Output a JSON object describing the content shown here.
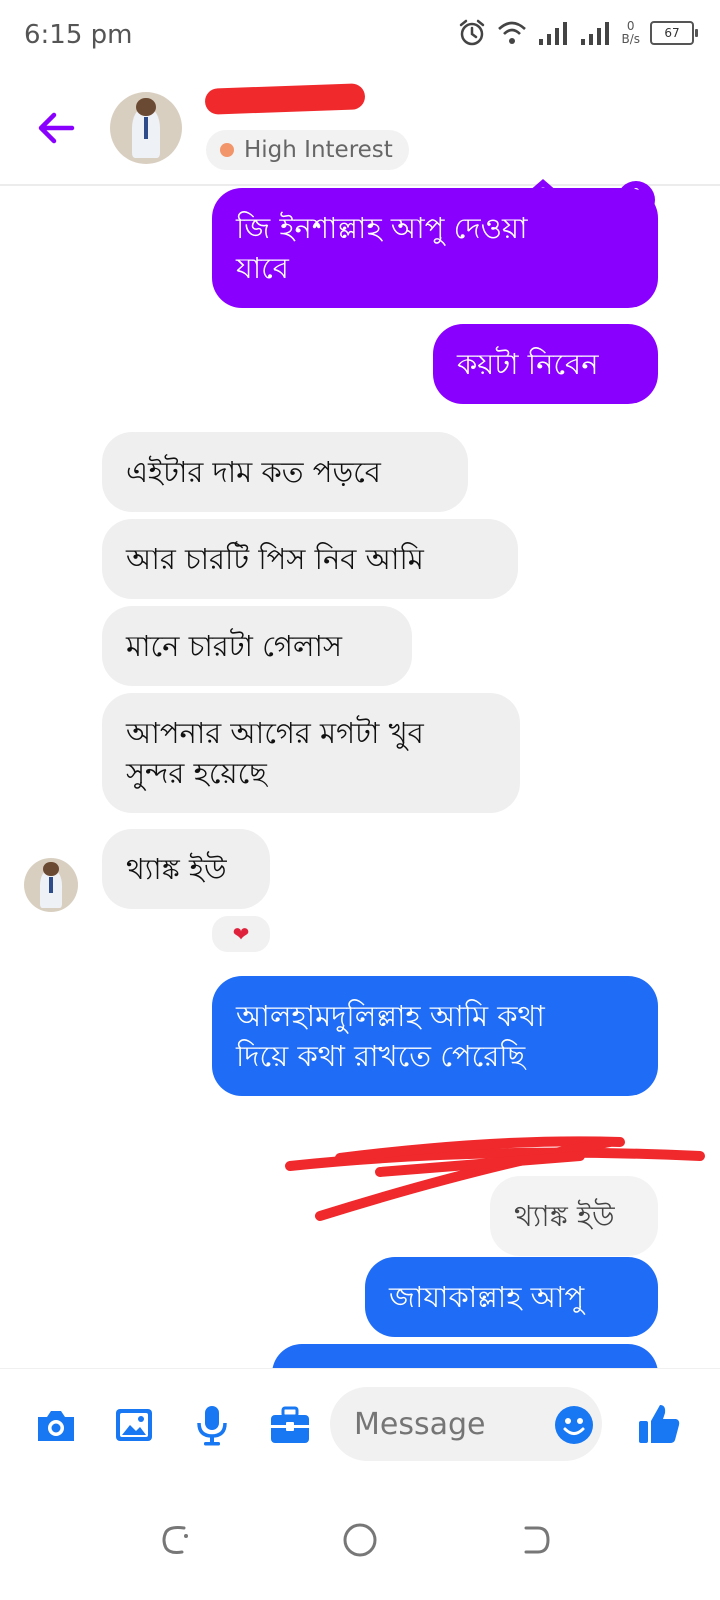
{
  "status_bar": {
    "time": "6:15 pm",
    "net_speed_value": "0",
    "net_speed_unit": "B/s",
    "battery": "67"
  },
  "header": {
    "interest_label": "High Interest",
    "interest_color": "#f2956b"
  },
  "colors": {
    "accent": "#8a00ff",
    "blue": "#1f6cf6",
    "incoming": "#efefef"
  },
  "messages": [
    {
      "dir": "out",
      "text": "জি ইনশাল্লাহ আপু দেওয়া\nযাবে"
    },
    {
      "dir": "out",
      "text": "কয়টা নিবেন"
    },
    {
      "dir": "in",
      "text": "এইটার দাম কত পড়বে"
    },
    {
      "dir": "in",
      "text": "আর চারটি পিস নিব আমি"
    },
    {
      "dir": "in",
      "text": "মানে চারটা গেলাস"
    },
    {
      "dir": "in",
      "text": "আপনার আগের মগটা খুব\nসুন্দর হয়েছে"
    },
    {
      "dir": "in",
      "text": "থ্যাঙ্ক ইউ",
      "reaction": "❤"
    },
    {
      "dir": "out",
      "text": "আলহামদুলিল্লাহ আমি কথা\nদিয়ে কথা রাখতে পেরেছি"
    },
    {
      "dir": "reply",
      "text": "থ্যাঙ্ক ইউ"
    },
    {
      "dir": "out",
      "text": "জাযাকাল্লাহ আপু"
    }
  ],
  "composer": {
    "placeholder": "Message",
    "icons": [
      "camera-icon",
      "gallery-icon",
      "microphone-icon",
      "briefcase-icon",
      "emoji-icon",
      "thumbs-up-icon"
    ]
  },
  "nav": {
    "icons": [
      "recent-apps-icon",
      "home-icon",
      "back-icon"
    ]
  }
}
